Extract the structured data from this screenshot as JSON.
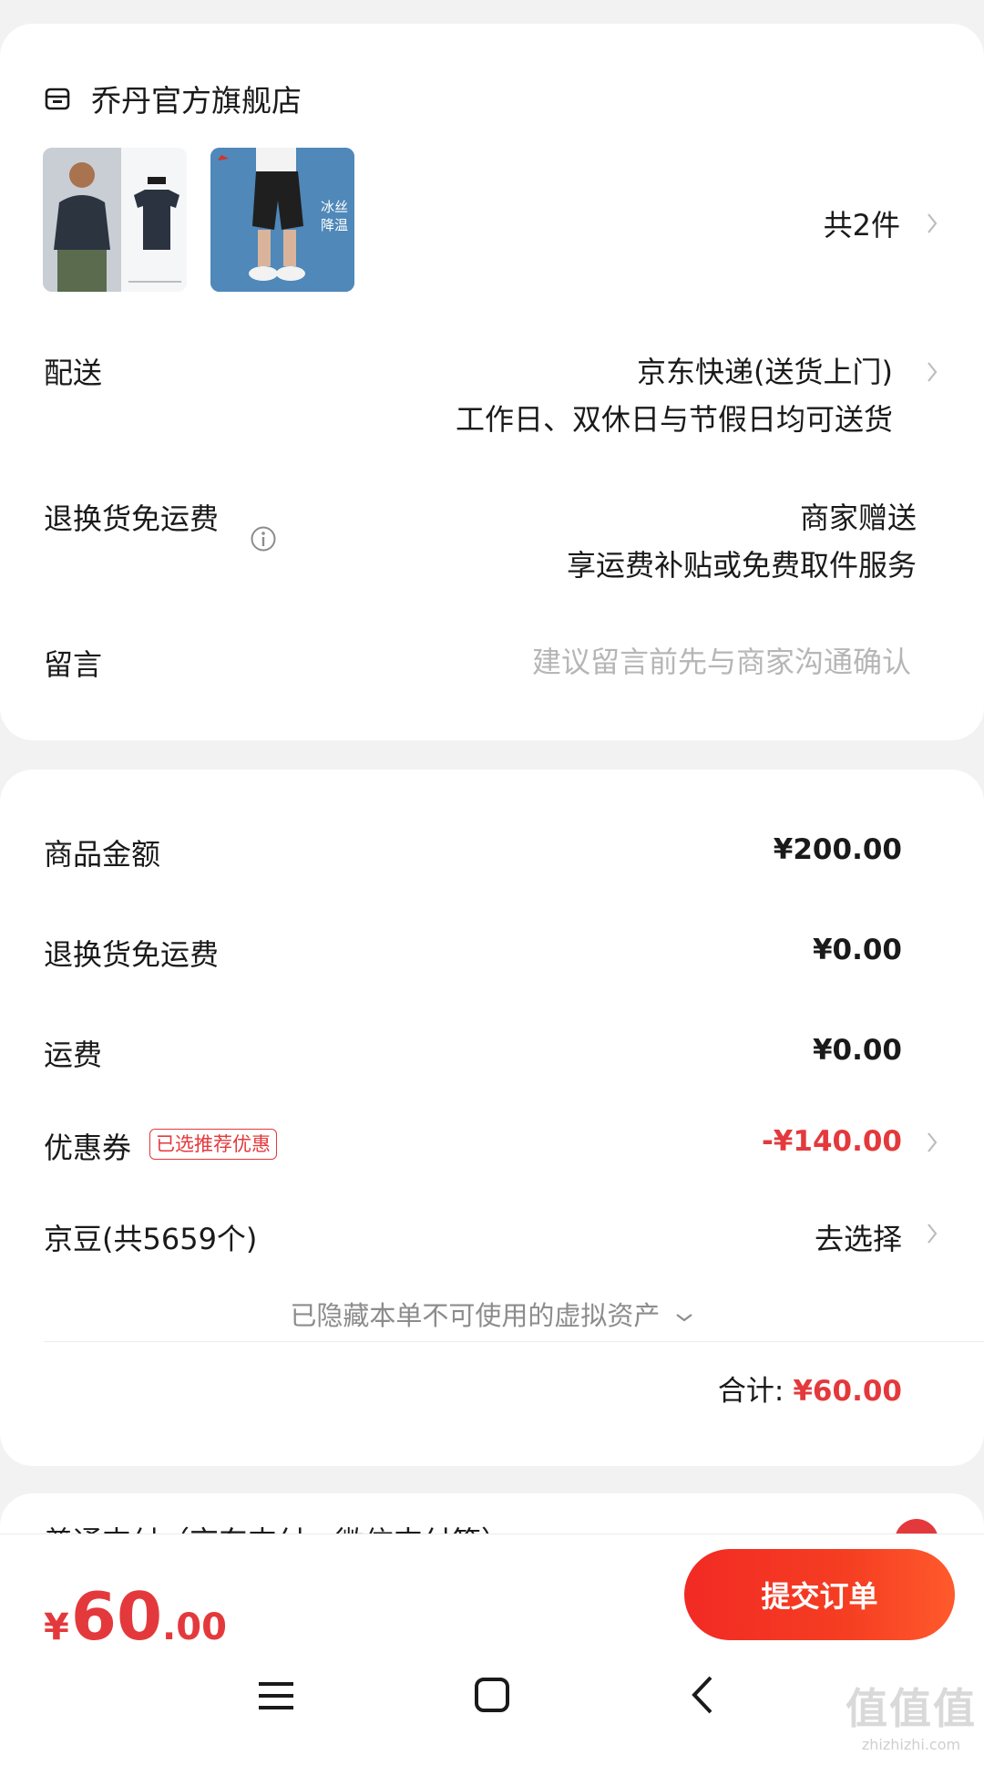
{
  "shop": {
    "name": "乔丹官方旗舰店",
    "icon": "store-icon"
  },
  "products": {
    "thumb1_alt": "男款短袖T恤",
    "thumb2_badge": "冰丝\n降温",
    "count_label": "共2件"
  },
  "delivery": {
    "label": "配送",
    "method": "京东快递(送货上门)",
    "note": "工作日、双休日与节假日均可送货"
  },
  "return_freight": {
    "label": "退换货免运费",
    "value": "商家赠送",
    "note": "享运费补贴或免费取件服务"
  },
  "message": {
    "label": "留言",
    "placeholder": "建议留言前先与商家沟通确认"
  },
  "summary": {
    "goods_label": "商品金额",
    "goods_value": "¥200.00",
    "return_label": "退换货免运费",
    "return_value": "¥0.00",
    "shipping_label": "运费",
    "shipping_value": "¥0.00",
    "coupon_label": "优惠券",
    "coupon_tag": "已选推荐优惠",
    "coupon_value": "-¥140.00",
    "beans_label": "京豆(共5659个)",
    "beans_value": "去选择",
    "hidden_hint": "已隐藏本单不可使用的虚拟资产",
    "total_label": "合计:",
    "total_value": "¥60.00"
  },
  "payment": {
    "peek_label": "普通支付（京东支付、微信支付等）"
  },
  "bottom": {
    "price_symbol": "¥",
    "price_int": "60",
    "price_dec": ".00",
    "submit_label": "提交订单"
  },
  "watermark": {
    "big": "值值值",
    "small": "zhizhizhi.com"
  },
  "colors": {
    "accent": "#e4393c",
    "button_start": "#f22a24",
    "button_end": "#ff5a2c"
  }
}
